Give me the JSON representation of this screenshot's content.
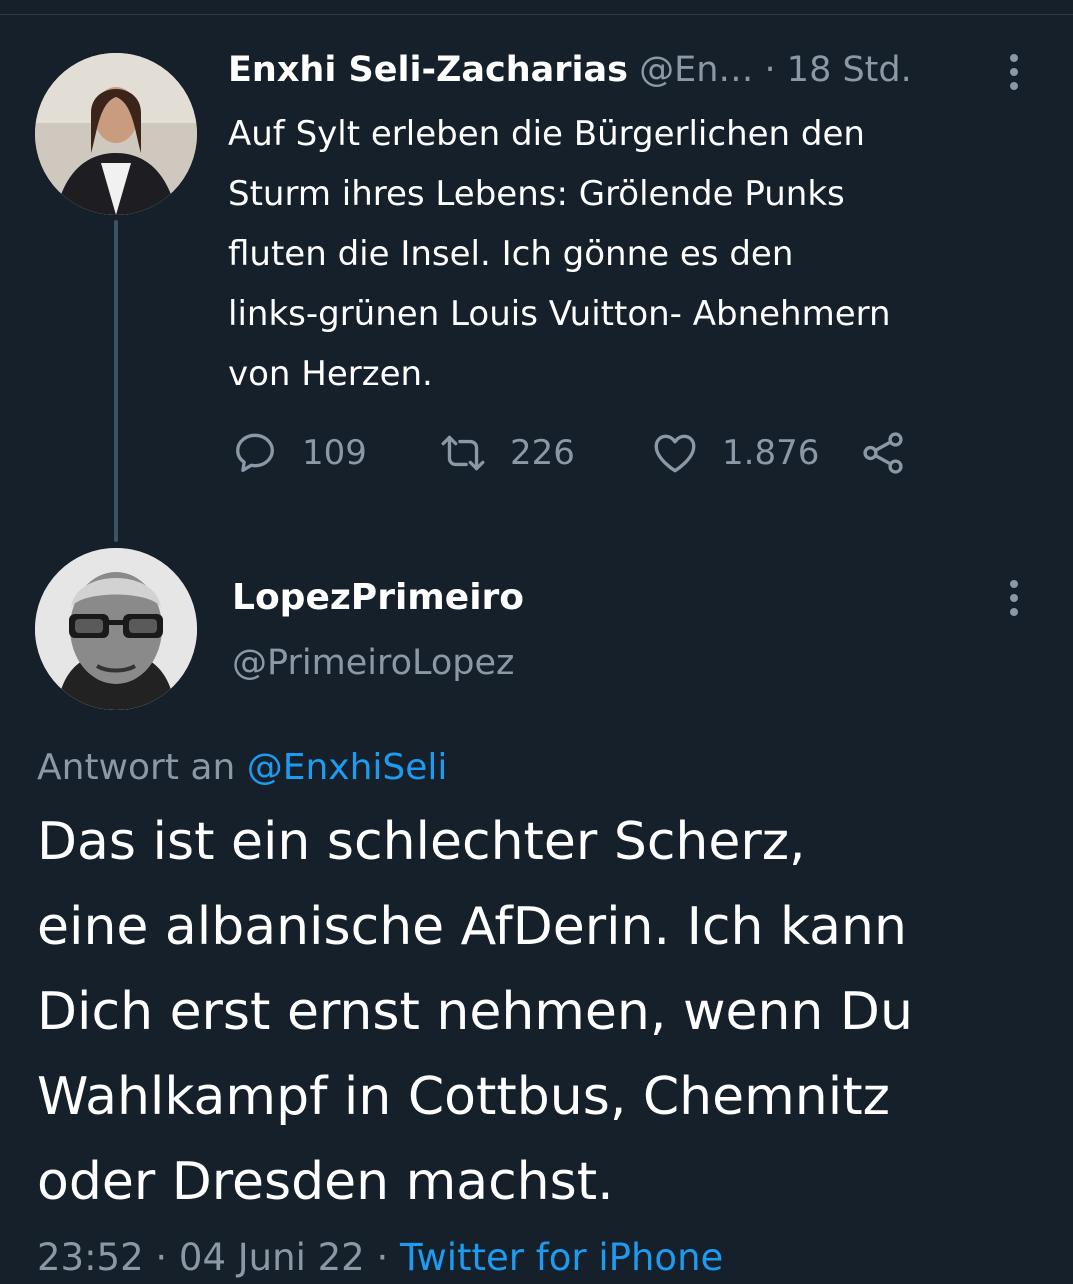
{
  "parent_tweet": {
    "display_name": "Enxhi Seli-Zacharias",
    "handle": "@En…",
    "time": "· 18 Std.",
    "text_lines": [
      "Auf Sylt erleben die Bürgerlichen den",
      "Sturm ihres Lebens: Grölende Punks",
      "fluten die Insel. Ich gönne es den",
      "links-grünen Louis Vuitton- Abnehmern",
      "von Herzen."
    ],
    "actions": {
      "replies": "109",
      "retweets": "226",
      "likes": "1.876"
    },
    "icons": [
      "reply-icon",
      "retweet-icon",
      "like-icon",
      "share-icon",
      "more-icon"
    ]
  },
  "reply_tweet": {
    "display_name": "LopezPrimeiro",
    "handle": "@PrimeiroLopez",
    "reply_prefix": "Antwort an",
    "reply_to": "@EnxhiSeli",
    "text_lines": [
      "Das ist ein schlechter Scherz,",
      "eine albanische AfDerin. Ich kann",
      "Dich erst ernst nehmen, wenn Du",
      "Wahlkampf in Cottbus, Chemnitz",
      "oder Dresden machst."
    ],
    "timestamp": "23:52 · 04 Juni 22 ·",
    "source": "Twitter for iPhone"
  },
  "colors": {
    "background": "#15202b",
    "muted": "#8b98a5",
    "link": "#1d9bf0"
  }
}
